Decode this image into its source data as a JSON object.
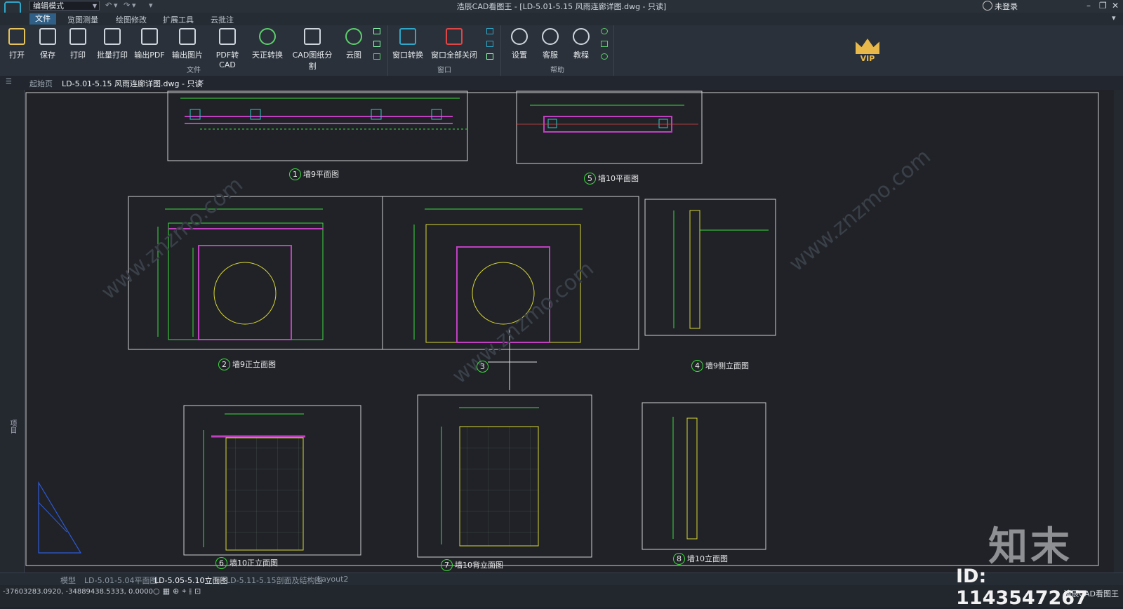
{
  "titlebar": {
    "mode": "编辑模式",
    "window_title": "浩辰CAD看图王 - [LD-5.01-5.15 风雨连廊详图.dwg - 只读]",
    "login": "未登录"
  },
  "menus": [
    "文件",
    "览图测量",
    "绘图修改",
    "扩展工具",
    "云批注"
  ],
  "ribbon": {
    "file_group": {
      "label": "文件",
      "buttons": [
        "打开",
        "保存",
        "打印",
        "批量打印",
        "输出PDF",
        "输出图片",
        "PDF转CAD",
        "天正转换",
        "CAD图纸分割",
        "云图"
      ]
    },
    "window_group": {
      "label": "窗口",
      "buttons": [
        "窗口转换",
        "窗口全部关闭"
      ]
    },
    "help_group": {
      "label": "帮助",
      "buttons": [
        "设置",
        "客服",
        "教程"
      ]
    },
    "vip": "VIP"
  },
  "doc_tabs": {
    "start": "起始页",
    "active": "LD-5.01-5.15 风雨连廊详图.dwg - 只读"
  },
  "side_panel_label": "项目",
  "drawing": {
    "views": [
      {
        "number": "1",
        "title": "墙9平面图"
      },
      {
        "number": "5",
        "title": "墙10平面图"
      },
      {
        "number": "2",
        "title": "墙9正立面图"
      },
      {
        "number": "3",
        "title": ""
      },
      {
        "number": "4",
        "title": "墙9侧立面图"
      },
      {
        "number": "6",
        "title": "墙10正立面图"
      },
      {
        "number": "7",
        "title": "墙10背立面图"
      },
      {
        "number": "8",
        "title": "墙10立面图"
      }
    ]
  },
  "layout_tabs": [
    "模型",
    "LD-5.01-5.04平面图",
    "LD-5.05-5.10立面图",
    "LD-5.11-5.15剖面及结构图",
    "Layout2"
  ],
  "active_layout": "LD-5.05-5.10立面图",
  "status": {
    "coords": "-37603283.0920, -34889438.5333, 0.0000",
    "app": "浩辰CAD看图王"
  },
  "watermark": {
    "big": "知末",
    "id": "ID: 1143547267"
  },
  "colors": {
    "accent": "#2f5f86",
    "cad_green": "#3ddc3d",
    "cad_yellow": "#d8d830",
    "cad_magenta": "#c040c0"
  }
}
